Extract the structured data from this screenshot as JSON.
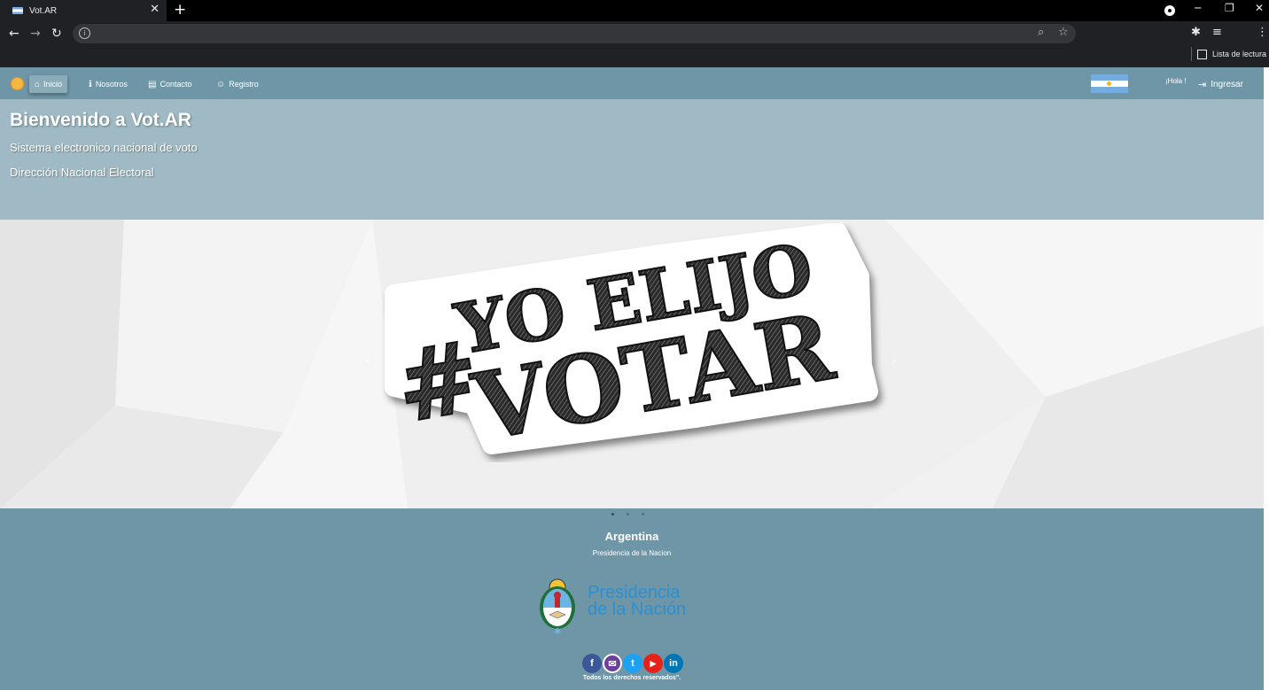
{
  "browser": {
    "tab_title": "Vot.AR",
    "tab_close": "✕",
    "new_tab": "+",
    "reading_list": "Lista de lectura"
  },
  "navbar": {
    "items": [
      {
        "label": "Inicio",
        "icon": "home-icon",
        "active": true
      },
      {
        "label": "Nosotros",
        "icon": "info-icon"
      },
      {
        "label": "Contacto",
        "icon": "contact-card-icon"
      },
      {
        "label": "Registro",
        "icon": "user-icon"
      }
    ],
    "greeting": "¡Hola !",
    "login_label": "Ingresar"
  },
  "hero": {
    "title": "Bienvenido a Vot.AR",
    "subtitle": "Sistema electronico nacional de voto",
    "organization": "Dirección Nacional Electoral"
  },
  "carousel": {
    "slide_line1": "#YO ELIJO",
    "slide_hash": "#",
    "slide_word1": "YO ELIJO",
    "slide_word2": "VOTAR",
    "prev": "‹",
    "next": "›",
    "slide_count": 3,
    "active_slide": 1
  },
  "footer": {
    "country": "Argentina",
    "subtitle": "Presidencia de la Nacion",
    "logo_line1": "Presidencia",
    "logo_line2": "de la Nación",
    "socials": [
      {
        "name": "facebook",
        "glyph": "f",
        "color": "#3b5998"
      },
      {
        "name": "email",
        "glyph": "✉",
        "color": "#6b3fa0"
      },
      {
        "name": "twitter",
        "glyph": "t",
        "color": "#1da1f2"
      },
      {
        "name": "youtube",
        "glyph": "▶",
        "color": "#e62117"
      },
      {
        "name": "linkedin",
        "glyph": "in",
        "color": "#0077b5"
      }
    ],
    "rights": "Todos los derechos reservados\"."
  }
}
